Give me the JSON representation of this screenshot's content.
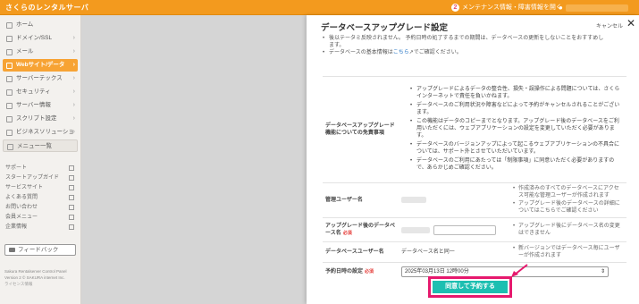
{
  "topbar": {
    "brand": "さくらのレンタルサーバ",
    "maintenance": "メンテナンス情報・障害情報を開く",
    "maint_badge": "2",
    "user_icon": "user-icon"
  },
  "sidebar": {
    "items": [
      {
        "label": "ホーム",
        "chevron": false,
        "active": false
      },
      {
        "label": "ドメイン/SSL",
        "chevron": true,
        "active": false
      },
      {
        "label": "メール",
        "chevron": true,
        "active": false
      },
      {
        "label": "Webサイト/データ",
        "chevron": true,
        "active": true
      },
      {
        "label": "サーバーテックス",
        "chevron": true,
        "active": false
      },
      {
        "label": "セキュリティ",
        "chevron": true,
        "active": false
      },
      {
        "label": "サーバー情報",
        "chevron": true,
        "active": false
      },
      {
        "label": "スクリプト設定",
        "chevron": true,
        "active": false
      },
      {
        "label": "ビジネスソリューション",
        "chevron": true,
        "active": false
      },
      {
        "label": "メニュー一覧",
        "chevron": false,
        "active": false
      }
    ],
    "links": [
      "サポート",
      "スタートアップガイド",
      "サービスサイト",
      "よくある質問",
      "お問い合わせ",
      "会員メニュー",
      "企業情報"
    ],
    "feedback": "フィードバック",
    "footer_line1": "Sakura Rentalserver Control Panel",
    "footer_line2": "Version 2 © SAKURA internet Inc.",
    "footer_line3": "ライセンス情報"
  },
  "drawer": {
    "title": "データベースアップグレード設定",
    "cancel": "キャンセル",
    "close": "✕",
    "intro_line1": "後以テータミ反映されません。 予約日時の処了するまでの期間は、データベースの更新をしないことをおすすめし",
    "intro_line1b": "ます。",
    "intro_line2_pre": "データベースの基本情報は",
    "intro_link": "こちら",
    "intro_line2_post": "でご確認ください。",
    "disclaimer_label": "データベースアップグレード機能についての免責事項",
    "disclaimers": [
      "アップグレードによるデータの整合性、損失・誤操作による問題については、さくらインターネットで責任を負いかねます。",
      "データベースのご利用状況や障害などによって予約がキャンセルされることがございます。",
      "この機能はデータのコピーまでとなります。アップグレード後のデータベースをご利用いただくには、ウェブアプリケーションの設定を変更していただく必要があります。",
      "データベースのバージョンアップによって起こるウェブアプリケーションの不具合については、サポート外とさせていただいています。",
      "データベースのご利用にあたっては「制限事項」に同意いただく必要がありますので、あらかじめご確認ください。"
    ],
    "admin_label": "管理ユーザー名",
    "admin_notes": [
      "作成済みのすべてのデータベースにアクセス可能な管理ユーザーが作成されます",
      "アップグレード後のデータベースの詳細についてはこちらでご確認ください"
    ],
    "newname_label": "アップグレード後のデータベース名",
    "newname_required": "必須",
    "newname_note": "アップグレード後にデータベース名の変更はできません",
    "dbuser_label": "データベースユーザー名",
    "dbuser_value": "データベース名と同一",
    "dbuser_note": "新バージョンではデータベース毎にユーザーが作成されます",
    "schedule_label": "予約日時の設定",
    "schedule_required": "必須",
    "schedule_value": "2025年03月13日 12時00分",
    "submit": "同意して予約する"
  }
}
